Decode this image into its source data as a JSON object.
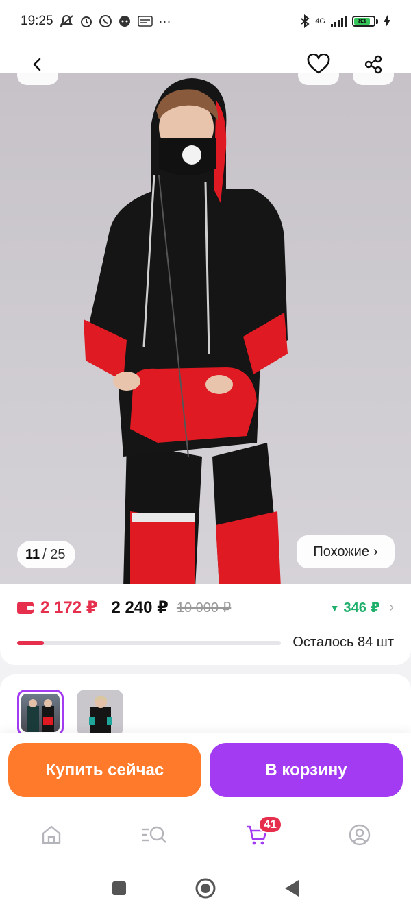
{
  "status_bar": {
    "time": "19:25",
    "network": "4G",
    "battery": "83"
  },
  "gallery": {
    "current": "11",
    "total": "25",
    "similar_label": "Похожие"
  },
  "price": {
    "wallet_price": "2 172 ₽",
    "price": "2 240 ₽",
    "old_price": "10 000 ₽",
    "discount": "346 ₽",
    "stock_label": "Осталось 84 шт",
    "stock_progress": 0.1
  },
  "actions": {
    "buy_now": "Купить сейчас",
    "add_to_cart": "В корзину"
  },
  "nav": {
    "cart_count": "41",
    "items": [
      "home-icon",
      "catalog-search-icon",
      "cart-icon",
      "profile-icon"
    ]
  },
  "colors": {
    "accent_purple": "#a23bf1",
    "accent_orange": "#ff7a2b",
    "wallet_red": "#e62e4d",
    "discount_green": "#1eaf6b"
  }
}
